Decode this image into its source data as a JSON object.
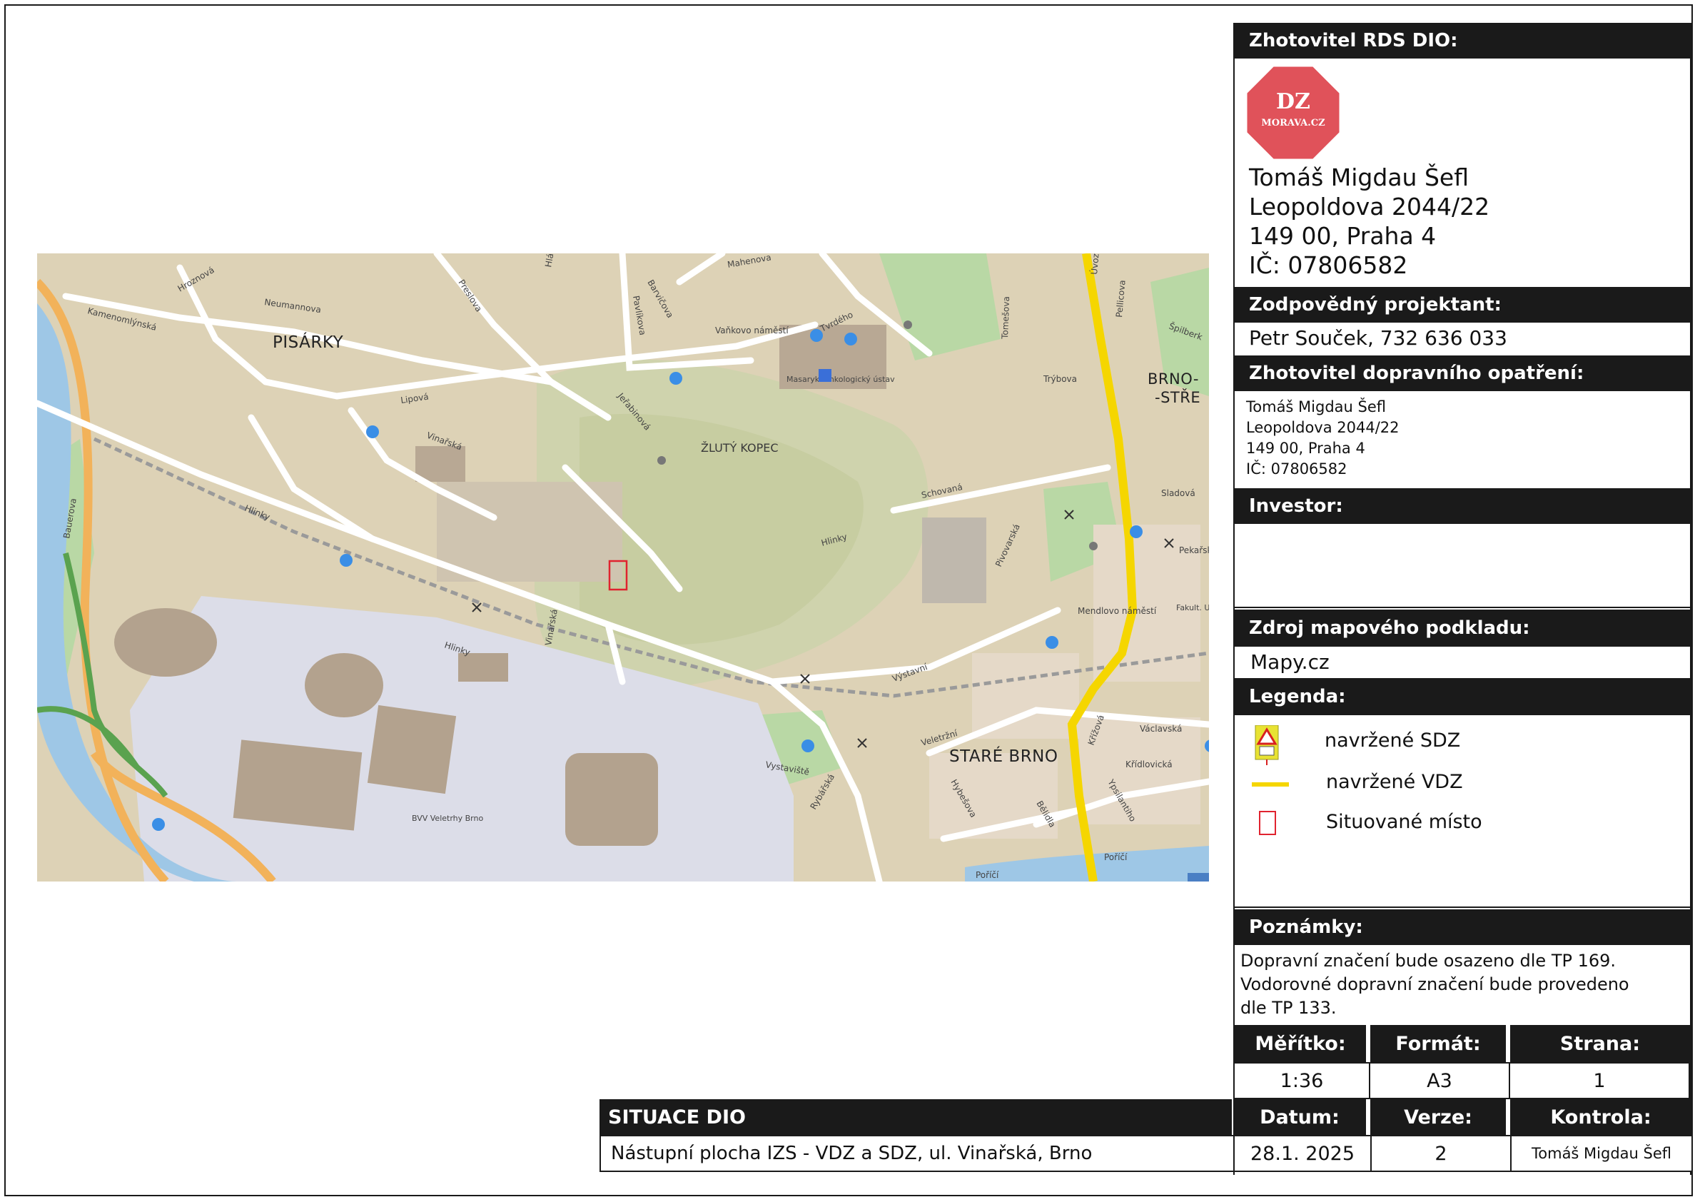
{
  "map": {
    "area_labels": [
      "PISÁRKY",
      "ŽLUTÝ KOPEC",
      "STARÉ BRNO",
      "BRNO-\n-STŘE"
    ],
    "street_labels": [
      "Hroznová",
      "Neumannova",
      "Kamenomlýnská",
      "Preslova",
      "Hlávkova",
      "Mahenova",
      "Barvičova",
      "Pavlíkova",
      "Lipová",
      "Vaňkovo náměstí",
      "Tvrdého",
      "Jeřabinová",
      "Vinařská",
      "Hlinky",
      "Bauerova",
      "Schovaná",
      "Pivovarská",
      "Mendlovo náměstí",
      "Úvoz",
      "Tomešova",
      "Trýbova",
      "Pellicova",
      "Špilberk",
      "Sladová",
      "Pekařská",
      "Výstavní",
      "Veletržní",
      "Václavská",
      "Křídlovická",
      "Poříčí",
      "Vystaviště",
      "Hybešova",
      "Bělidla",
      "Křížová",
      "Rybářská",
      "Ypsilantiho",
      "Žlutý kopec",
      "Masaryk. onkologický ústav",
      "BVV Veletrhy Brno",
      "Fakult. U sv."
    ],
    "site_marker_color": "#e0232f",
    "route_color": "#f5d600"
  },
  "panel": {
    "zhotovitel_rds_header": "Zhotovitel RDS DIO:",
    "logo": {
      "line1": "DZ",
      "line2": "MORAVA.CZ",
      "color": "#e0525a"
    },
    "zhotovitel_lines": [
      "Tomáš Migdau Šefl",
      "Leopoldova 2044/22",
      "149 00, Praha 4",
      "IČ: 07806582"
    ],
    "projektant_header": "Zodpovědný projektant:",
    "projektant_value": "Petr Souček, 732 636 033",
    "dopravni_header": "Zhotovitel dopravního opatření:",
    "dopravni_lines": [
      "Tomáš Migdau Šefl",
      "Leopoldova 2044/22",
      "149 00, Praha 4",
      "IČ: 07806582"
    ],
    "investor_header": "Investor:",
    "zdroj_header": "Zdroj mapového podkladu:",
    "zdroj_value": "Mapy.cz",
    "legenda_header": "Legenda:",
    "legend": [
      {
        "icon": "sdz-sign-icon",
        "label": "navržené SDZ"
      },
      {
        "icon": "vdz-line-icon",
        "label": "navržené VDZ"
      },
      {
        "icon": "site-rect-icon",
        "label": "Situované místo"
      }
    ],
    "poznamky_header": "Poznámky:",
    "poznamky_lines": [
      "Dopravní značení bude osazeno dle TP 169.",
      "Vodorovné dopravní značení bude provedeno",
      "dle TP 133."
    ]
  },
  "table": {
    "meritko_label": "Měřítko:",
    "meritko_value": "1:36",
    "format_label": "Formát:",
    "format_value": "A3",
    "strana_label": "Strana:",
    "strana_value": "1",
    "situace_label": "SITUACE DIO",
    "situace_value": "Nástupní plocha IZS - VDZ a SDZ, ul. Vinařská, Brno",
    "datum_label": "Datum:",
    "datum_value": "28.1. 2025",
    "verze_label": "Verze:",
    "verze_value": "2",
    "kontrola_label": "Kontrola:",
    "kontrola_value": "Tomáš Migdau Šefl"
  }
}
